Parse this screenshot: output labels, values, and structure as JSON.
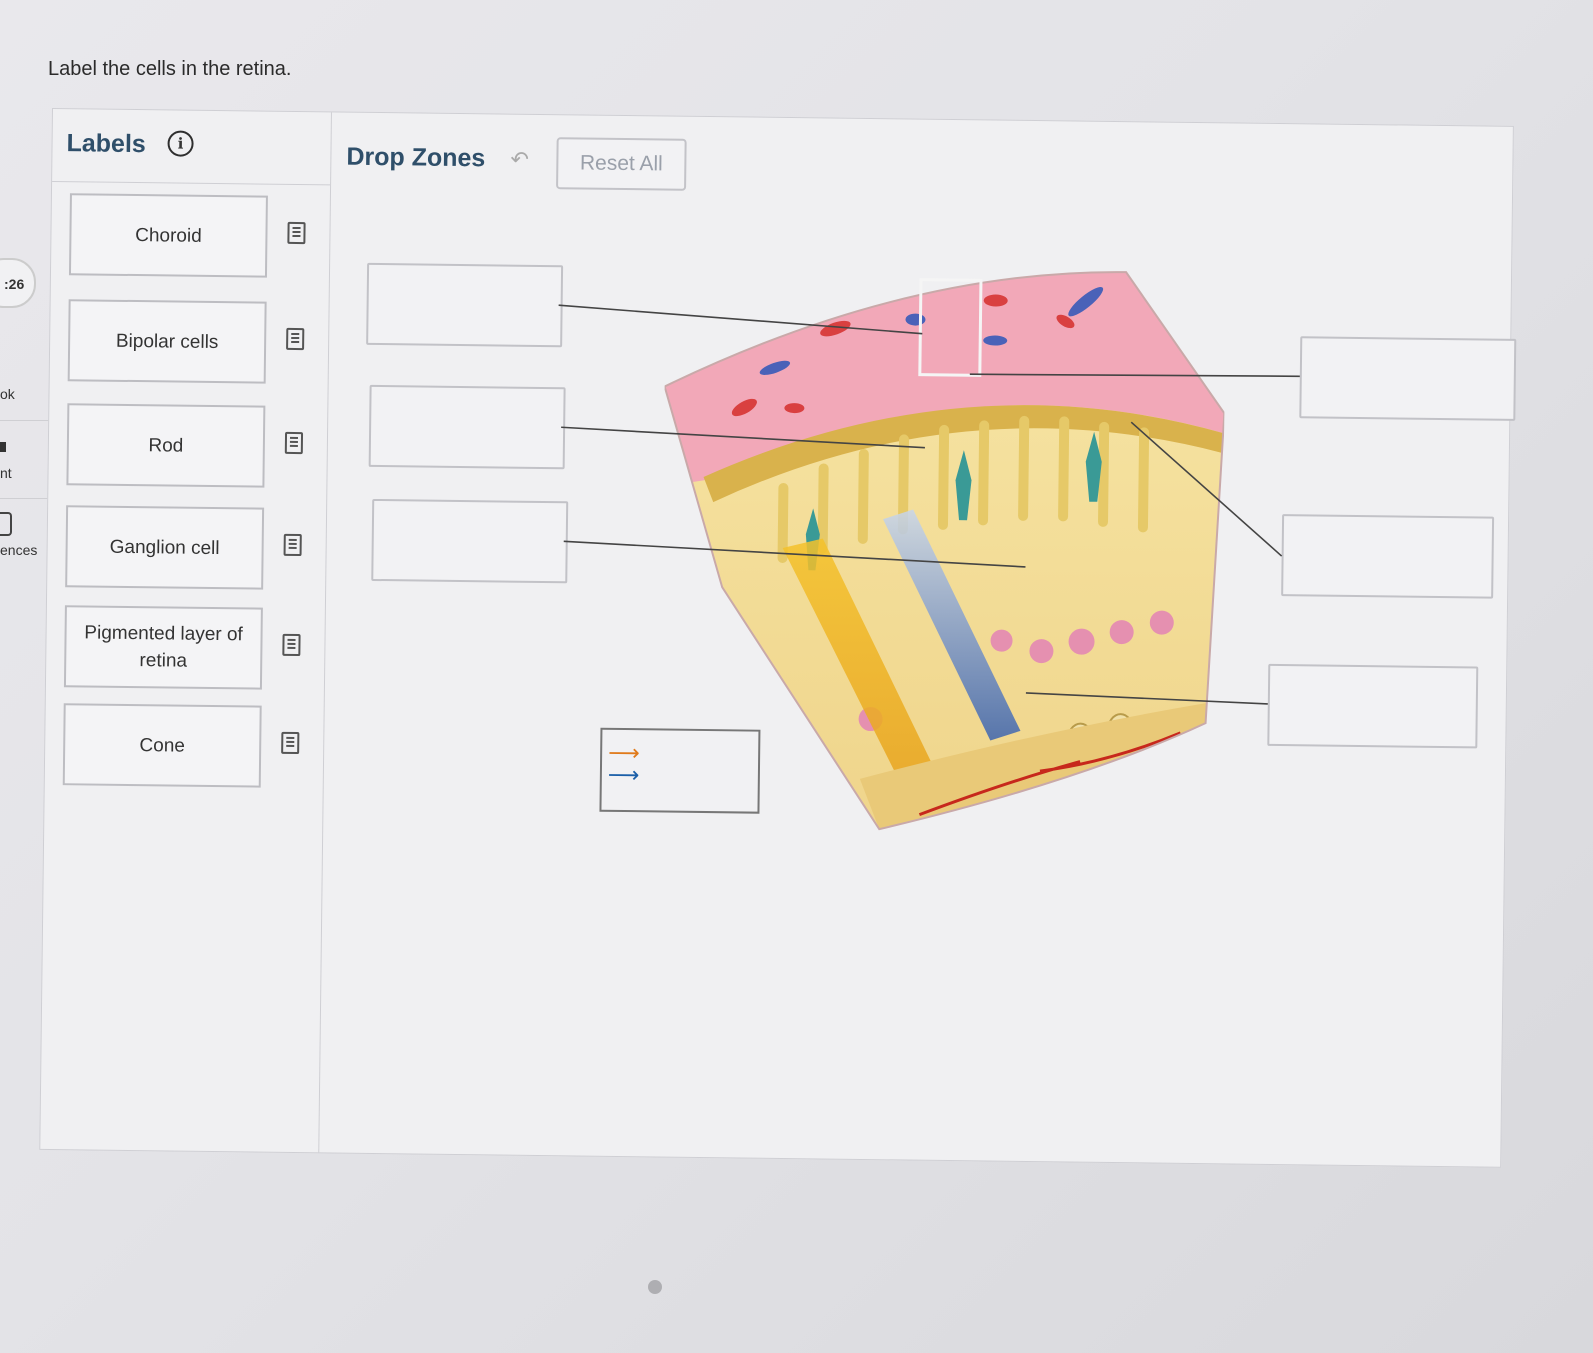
{
  "sidebar": {
    "timer": ":26",
    "item_1": "ok",
    "item_2": "nt",
    "item_3": "ences"
  },
  "question": "Label the cells in the retina.",
  "labels_panel": {
    "title": "Labels",
    "items": [
      {
        "label": "Choroid"
      },
      {
        "label": "Bipolar cells"
      },
      {
        "label": "Rod"
      },
      {
        "label": "Ganglion cell"
      },
      {
        "label": "Pigmented layer of retina"
      },
      {
        "label": "Cone"
      }
    ]
  },
  "drop_zones": {
    "title": "Drop Zones",
    "reset_label": "Reset All",
    "undo_icon": "undo-arrow-icon",
    "zones_count_left": 3,
    "zones_count_right": 3
  },
  "legend": {
    "arrow_1_color": "#e07a1a",
    "arrow_2_color": "#1b5fa8"
  },
  "colors": {
    "heading": "#2f4f6a",
    "choroid_pink": "#f2a8b8",
    "photoreceptor_yellow": "#f3dc86"
  }
}
